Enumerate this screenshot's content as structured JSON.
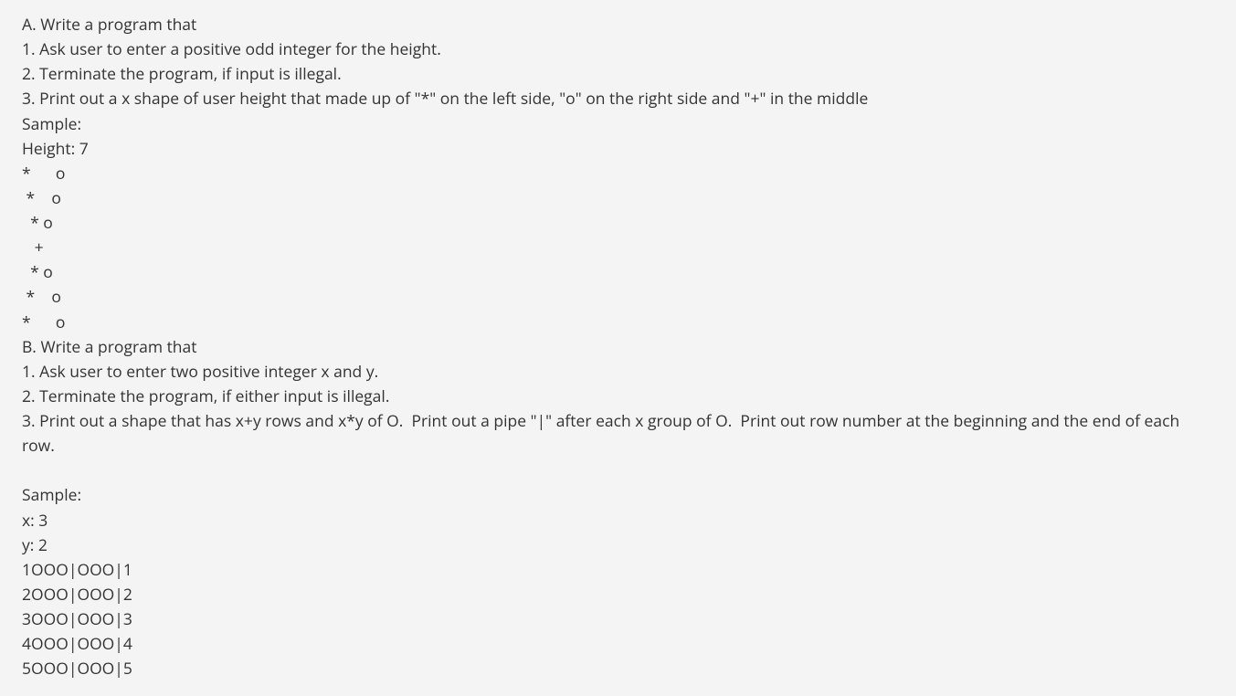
{
  "lines": [
    "A. Write a program that",
    "1. Ask user to enter a positive odd integer for the height.",
    "2. Terminate the program, if input is illegal.",
    "3. Print out a x shape of user height that made up of \"*\" on the left side, \"o\" on the right side and \"+\" in the middle",
    "Sample:",
    "Height: 7",
    "*      o",
    " *    o",
    "  * o",
    "   +",
    "  * o",
    " *    o",
    "*      o",
    "B. Write a program that",
    "1. Ask user to enter two positive integer x and y.",
    "2. Terminate the program, if either input is illegal.",
    "3. Print out a shape that has x+y rows and x*y of O.  Print out a pipe \"|\" after each x group of O.  Print out row number at the beginning and the end of each row.",
    "",
    "Sample:",
    "x: 3",
    "y: 2",
    "1OOO|OOO|1",
    "2OOO|OOO|2",
    "3OOO|OOO|3",
    "4OOO|OOO|4",
    "5OOO|OOO|5"
  ]
}
